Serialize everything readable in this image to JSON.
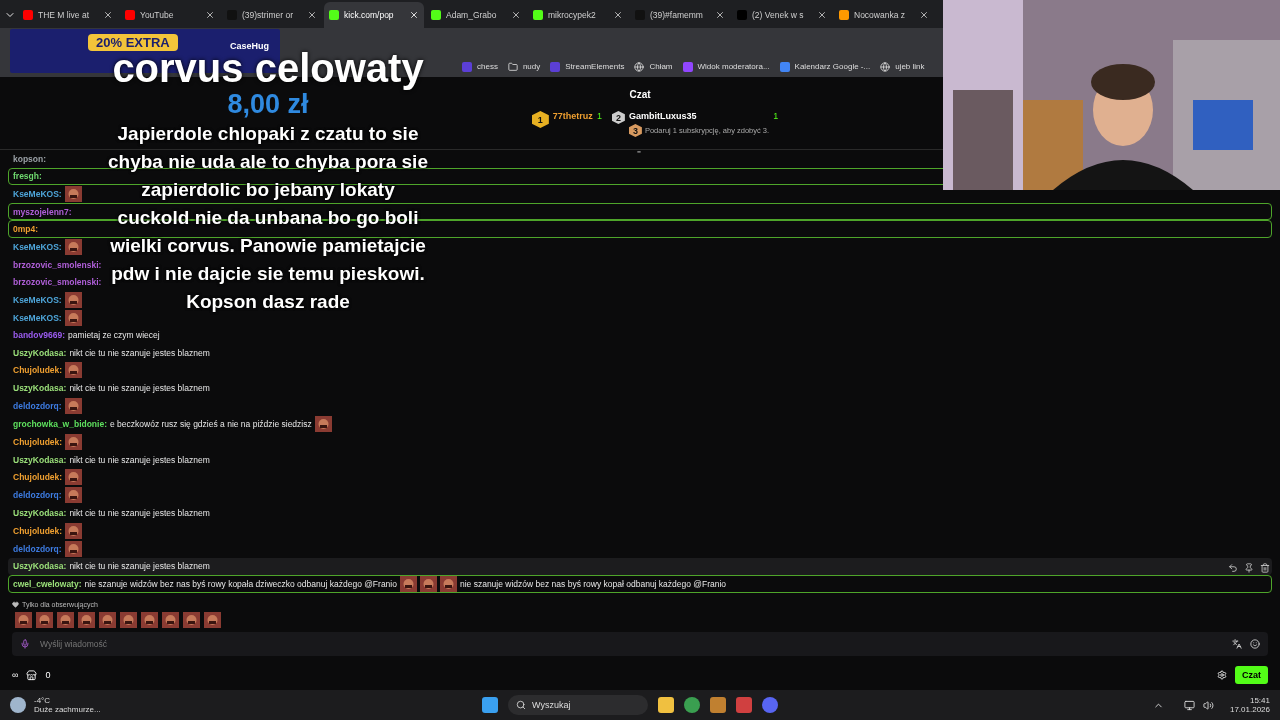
{
  "browser": {
    "tabs": [
      {
        "label": "THE M live at",
        "selected": false,
        "kind": "youtube"
      },
      {
        "label": "YouTube",
        "selected": false,
        "kind": "youtube"
      },
      {
        "label": "(39)strimer or",
        "selected": false,
        "kind": "tiktok"
      },
      {
        "label": "kick.com/pop",
        "selected": true,
        "kind": "kick"
      },
      {
        "label": "Adam_Grabo",
        "selected": false,
        "kind": "kick"
      },
      {
        "label": "mikrocypek2",
        "selected": false,
        "kind": "kick"
      },
      {
        "label": "(39)#famemm",
        "selected": false,
        "kind": "tiktok"
      },
      {
        "label": "(2) Venek w s",
        "selected": false,
        "kind": "x"
      },
      {
        "label": "Nocowanka z",
        "selected": false,
        "kind": "amazon"
      }
    ],
    "bookmarks": [
      {
        "label": "chess",
        "kind": "site"
      },
      {
        "label": "nudy",
        "kind": "folder"
      },
      {
        "label": "StreamElements",
        "kind": "site"
      },
      {
        "label": "Chłam",
        "kind": "globe"
      },
      {
        "label": "Widok moderatora...",
        "kind": "twitch"
      },
      {
        "label": "Kalendarz Google -...",
        "kind": "calendar"
      },
      {
        "label": "ujeb link",
        "kind": "globe"
      }
    ]
  },
  "overlay": {
    "ad": {
      "badge": "20% EXTRA",
      "brand": "CaseHug"
    },
    "donor": "corvus celowaty",
    "amount": "8,00 zł",
    "message": "Japierdole chlopaki z czatu to sie chyba nie uda ale to chyba pora sie zapierdolic bo jebany lokaty cuckold nie da unbana bo go boli wielki corvus. Panowie pamietajcie pdw i nie dajcie sie temu pieskowi. Kopson dasz rade"
  },
  "chat": {
    "title": "Czat",
    "leaderboard": [
      {
        "rank": "1",
        "name": "77thetruz",
        "count": "1"
      },
      {
        "rank": "2",
        "name": "GambitLuxus35",
        "count": "1"
      }
    ],
    "gift_hint": {
      "rank": "3",
      "text": "Podaruj 1 subskrypcję, aby zdobyć 3."
    },
    "messages": [
      {
        "user": "kopson:",
        "color": "#9aa0a6",
        "highlighted": false,
        "hovered": false
      },
      {
        "user": "fresgh:",
        "color": "#6fd96f",
        "highlighted": true,
        "hovered": false
      },
      {
        "user": "KseMeKOS:",
        "color": "#4ea5d9",
        "highlighted": false,
        "hovered": false,
        "emotes": [
          {
            "kind": "emote"
          }
        ]
      },
      {
        "user": "myszojelenn7:",
        "color": "#b05fd9",
        "highlighted": true,
        "hovered": false
      },
      {
        "user": "0mp4:",
        "color": "#f0a030",
        "highlighted": true,
        "hovered": false
      },
      {
        "user": "KseMeKOS:",
        "color": "#4ea5d9",
        "highlighted": false,
        "hovered": false,
        "emotes": [
          {
            "kind": "emote"
          }
        ]
      },
      {
        "user": "brzozovic_smolenski:",
        "color": "#b05fd9",
        "highlighted": false,
        "hovered": false
      },
      {
        "user": "brzozovic_smolenski:",
        "color": "#b05fd9",
        "highlighted": false,
        "hovered": false
      },
      {
        "user": "KseMeKOS:",
        "color": "#4ea5d9",
        "highlighted": false,
        "hovered": false,
        "emotes": [
          {
            "kind": "emote"
          }
        ]
      },
      {
        "user": "KseMeKOS:",
        "color": "#4ea5d9",
        "highlighted": false,
        "hovered": false,
        "emotes": [
          {
            "kind": "emote"
          }
        ]
      },
      {
        "user": "bandov9669:",
        "color": "#9b5cf0",
        "text": "pamietaj ze czym wiecej",
        "highlighted": false,
        "hovered": false
      },
      {
        "user": "UszyKodasa:",
        "color": "#9be07a",
        "text": "nikt cie tu nie szanuje jestes blaznem",
        "highlighted": false,
        "hovered": false
      },
      {
        "user": "Chujoludek:",
        "color": "#f0a030",
        "highlighted": false,
        "hovered": false,
        "emotes": [
          {
            "kind": "emote"
          }
        ]
      },
      {
        "user": "UszyKodasa:",
        "color": "#9be07a",
        "text": "nikt cie tu nie szanuje jestes blaznem",
        "highlighted": false,
        "hovered": false
      },
      {
        "user": "deldozdorq:",
        "color": "#3d7be0",
        "highlighted": false,
        "hovered": false,
        "emotes": [
          {
            "kind": "emote"
          }
        ]
      },
      {
        "user": "grochowka_w_bidonie:",
        "color": "#5ee05e",
        "text": "e beczkowóz rusz się gdzieś a nie na piździe siedzisz",
        "highlighted": false,
        "hovered": false,
        "emotes": [
          {
            "kind": "emote"
          }
        ]
      },
      {
        "user": "Chujoludek:",
        "color": "#f0a030",
        "highlighted": false,
        "hovered": false,
        "emotes": [
          {
            "kind": "emote"
          }
        ]
      },
      {
        "user": "UszyKodasa:",
        "color": "#9be07a",
        "text": "nikt cie tu nie szanuje jestes blaznem",
        "highlighted": false,
        "hovered": false
      },
      {
        "user": "Chujoludek:",
        "color": "#f0a030",
        "highlighted": false,
        "hovered": false,
        "emotes": [
          {
            "kind": "emote"
          }
        ]
      },
      {
        "user": "deldozdorq:",
        "color": "#3d7be0",
        "highlighted": false,
        "hovered": false,
        "emotes": [
          {
            "kind": "emote"
          }
        ]
      },
      {
        "user": "UszyKodasa:",
        "color": "#9be07a",
        "text": "nikt cie tu nie szanuje jestes blaznem",
        "highlighted": false,
        "hovered": false
      },
      {
        "user": "Chujoludek:",
        "color": "#f0a030",
        "highlighted": false,
        "hovered": false,
        "emotes": [
          {
            "kind": "emote"
          }
        ]
      },
      {
        "user": "deldozdorq:",
        "color": "#3d7be0",
        "highlighted": false,
        "hovered": false,
        "emotes": [
          {
            "kind": "emote"
          }
        ]
      },
      {
        "user": "UszyKodasa:",
        "color": "#9be07a",
        "text": "nikt cie tu nie szanuje jestes blaznem",
        "highlighted": false,
        "hovered": true
      },
      {
        "user": "cwel_cwelowaty:",
        "color": "#9be07a",
        "text": "nie szanuje widzów bez nas byś rowy kopała dziweczko odbanuj każdego @Franio",
        "text2": "nie szanuje widzów bez nas byś rowy kopał odbanuj każdego @Franio",
        "highlighted": true,
        "hovered": false,
        "emotes": [
          {
            "kind": "emote"
          },
          {
            "kind": "emote"
          },
          {
            "kind": "emote"
          }
        ]
      }
    ],
    "followers_only": "Tylko dla obserwujących",
    "emote_bar": [
      {
        "kind": "emote"
      },
      {
        "kind": "emote"
      },
      {
        "kind": "emote"
      },
      {
        "kind": "emote"
      },
      {
        "kind": "emote"
      },
      {
        "kind": "emote"
      },
      {
        "kind": "emote"
      },
      {
        "kind": "emote"
      },
      {
        "kind": "emote"
      },
      {
        "kind": "emote"
      }
    ],
    "input": {
      "placeholder": "Wyślij wiadomość"
    },
    "points": "∞",
    "store_count": "0",
    "send_button": "Czat"
  },
  "taskbar": {
    "temperature": "-4°C",
    "weather": "Duże zachmurze...",
    "search_placeholder": "Wyszukaj",
    "time": "15:41",
    "date": "17.01.2026"
  }
}
